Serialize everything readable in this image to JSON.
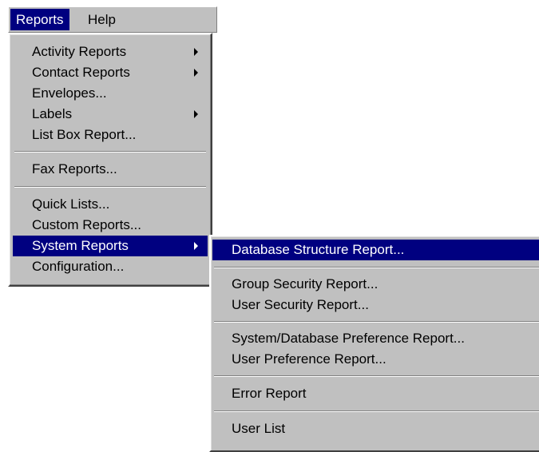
{
  "menubar": {
    "items": [
      {
        "label": "Reports",
        "active": true
      },
      {
        "label": "Help",
        "active": false
      }
    ]
  },
  "reports_menu": {
    "items": [
      {
        "label": "Activity Reports",
        "has_submenu": true
      },
      {
        "label": "Contact Reports",
        "has_submenu": true
      },
      {
        "label": "Envelopes...",
        "has_submenu": false
      },
      {
        "label": "Labels",
        "has_submenu": true
      },
      {
        "label": "List Box Report...",
        "has_submenu": false
      },
      {
        "label": "Fax Reports...",
        "has_submenu": false
      },
      {
        "label": "Quick Lists...",
        "has_submenu": false
      },
      {
        "label": "Custom Reports...",
        "has_submenu": false
      },
      {
        "label": "System Reports",
        "has_submenu": true,
        "highlighted": true
      },
      {
        "label": "Configuration...",
        "has_submenu": false
      }
    ]
  },
  "system_reports_submenu": {
    "items": [
      {
        "label": "Database Structure Report...",
        "highlighted": true
      },
      {
        "label": "Group Security Report..."
      },
      {
        "label": "User Security Report..."
      },
      {
        "label": "System/Database Preference Report..."
      },
      {
        "label": "User Preference Report..."
      },
      {
        "label": "Error Report"
      },
      {
        "label": "User List"
      }
    ]
  },
  "colors": {
    "menu_bg": "#c0c0c0",
    "highlight_bg": "#000080",
    "highlight_text": "#ffffff"
  }
}
